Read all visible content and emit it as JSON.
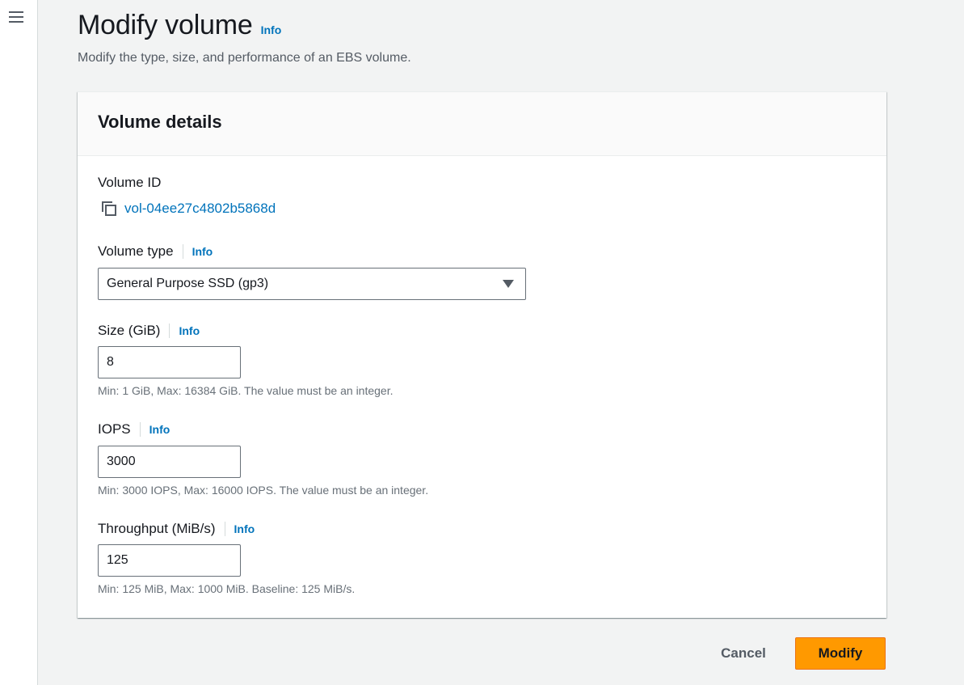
{
  "page": {
    "title": "Modify volume",
    "title_info": "Info",
    "description": "Modify the type, size, and performance of an EBS volume."
  },
  "panel": {
    "title": "Volume details",
    "volume_id": {
      "label": "Volume ID",
      "value": "vol-04ee27c4802b5868d"
    },
    "volume_type": {
      "label": "Volume type",
      "info": "Info",
      "selected": "General Purpose SSD (gp3)"
    },
    "size": {
      "label": "Size (GiB)",
      "info": "Info",
      "value": "8",
      "hint": "Min: 1 GiB, Max: 16384 GiB. The value must be an integer."
    },
    "iops": {
      "label": "IOPS",
      "info": "Info",
      "value": "3000",
      "hint": "Min: 3000 IOPS, Max: 16000 IOPS. The value must be an integer."
    },
    "throughput": {
      "label": "Throughput (MiB/s)",
      "info": "Info",
      "value": "125",
      "hint": "Min: 125 MiB, Max: 1000 MiB. Baseline: 125 MiB/s."
    }
  },
  "actions": {
    "cancel_label": "Cancel",
    "modify_label": "Modify"
  },
  "icons": {
    "menu": "hamburger-menu-icon",
    "copy": "copy-icon",
    "dropdown": "caret-down-icon"
  },
  "colors": {
    "link": "#0073bb",
    "primary_button": "#ff9900",
    "page_background": "#f2f3f3"
  }
}
